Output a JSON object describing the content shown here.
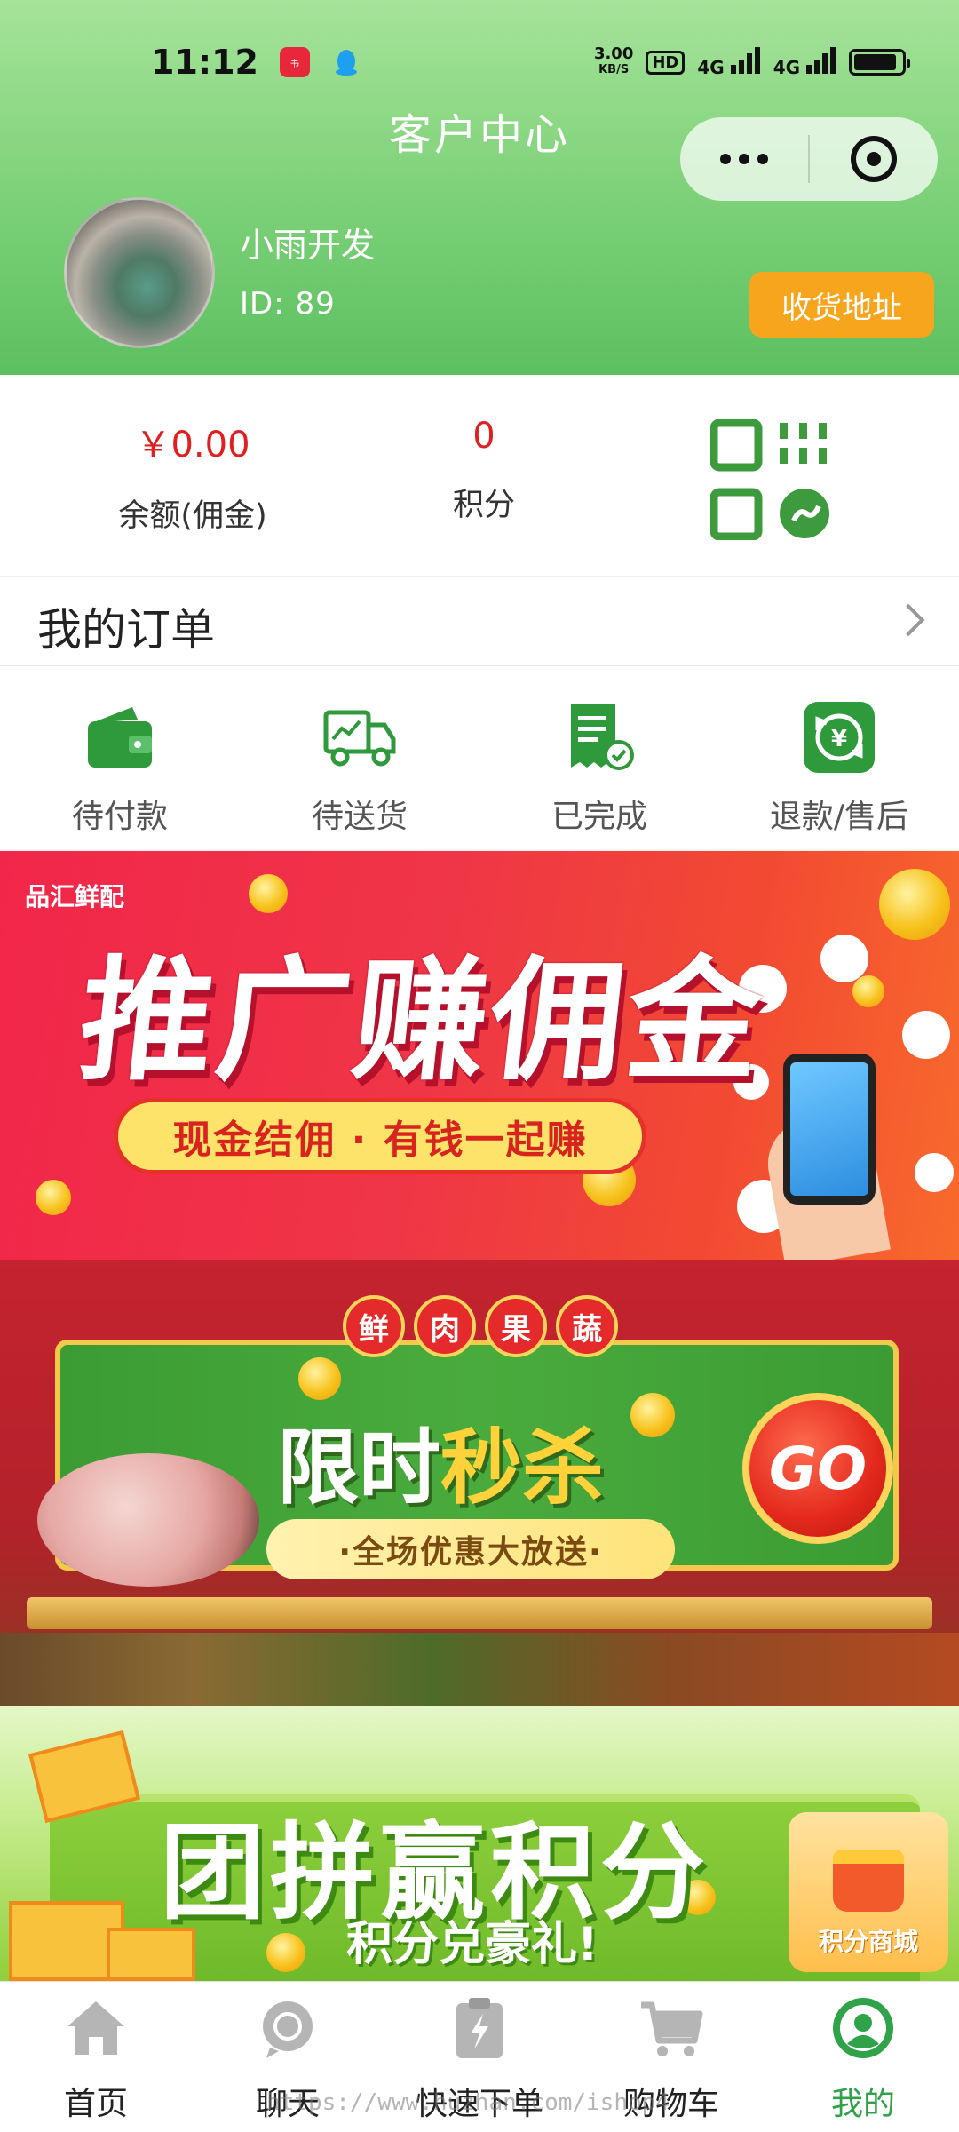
{
  "status_bar": {
    "time": "11:12",
    "speed_value": "3.00",
    "speed_unit": "KB/S",
    "hd": "HD",
    "net1": "4G",
    "net2": "4G",
    "battery_level": 0.9
  },
  "header": {
    "title": "客户中心",
    "user_name": "小雨开发",
    "user_id": "ID: 89",
    "address_button": "收货地址"
  },
  "balance": {
    "amount": "￥0.00",
    "amount_label": "余额(佣金)",
    "points": "0",
    "points_label": "积分"
  },
  "orders": {
    "title": "我的订单",
    "items": [
      {
        "label": "待付款",
        "icon": "wallet-icon"
      },
      {
        "label": "待送货",
        "icon": "truck-icon"
      },
      {
        "label": "已完成",
        "icon": "receipt-check-icon"
      },
      {
        "label": "退款/售后",
        "icon": "refund-icon"
      }
    ]
  },
  "banners": {
    "promo": {
      "brand": "品汇鲜配",
      "title": "推广赚佣金",
      "subtitle": "现金结佣 · 有钱一起赚"
    },
    "flash": {
      "tags": [
        "鲜",
        "肉",
        "果",
        "蔬"
      ],
      "title_a": "限时",
      "title_b": "秒杀",
      "subtitle": "·全场优惠大放送·",
      "go": "GO"
    },
    "group": {
      "title": "团拼赢积分",
      "subtitle": "积分兑豪礼!",
      "shop_label": "积分商城"
    }
  },
  "tabbar": {
    "items": [
      {
        "label": "首页",
        "icon": "home-icon"
      },
      {
        "label": "聊天",
        "icon": "chat-icon"
      },
      {
        "label": "快速下单",
        "icon": "quick-order-icon"
      },
      {
        "label": "购物车",
        "icon": "cart-icon"
      },
      {
        "label": "我的",
        "icon": "profile-icon"
      }
    ],
    "active": 4
  },
  "watermark": "https://www.huzhan.com/ishop4",
  "colors": {
    "accent_green": "#2fa24a",
    "price_red": "#e02020",
    "address_orange": "#f7a51c"
  }
}
